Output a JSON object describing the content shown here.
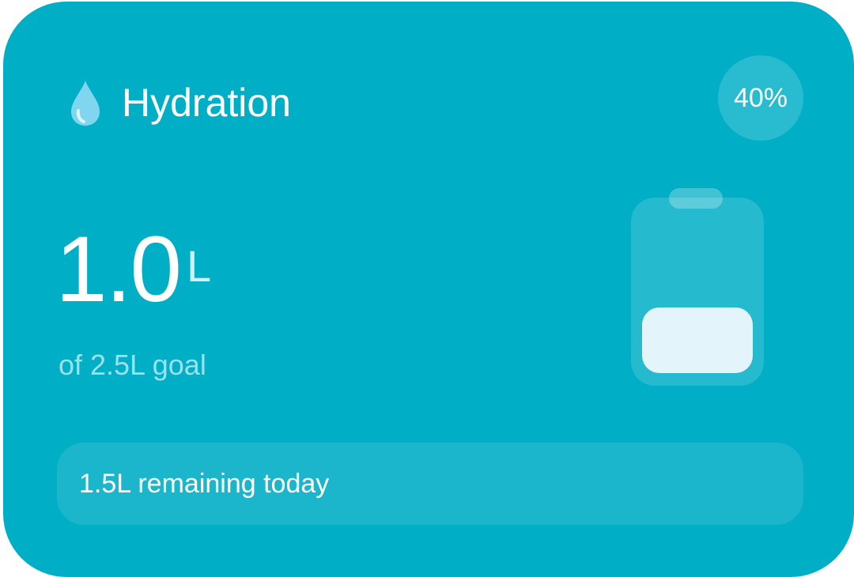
{
  "widget": {
    "title": "Hydration",
    "percent_label": "40%",
    "percent_value": 40,
    "amount": "1.0",
    "unit": "L",
    "goal_text": "of 2.5L goal",
    "remaining_text": "1.5L remaining today",
    "icon": "water-drop-icon",
    "bottle_icon": "water-bottle-icon",
    "fill_fraction": 0.4
  },
  "colors": {
    "card_background": "#00AEC6",
    "drop": "#7FD6EE",
    "bottle_fill": "#E3F4FB",
    "text": "#FFFFFF"
  }
}
